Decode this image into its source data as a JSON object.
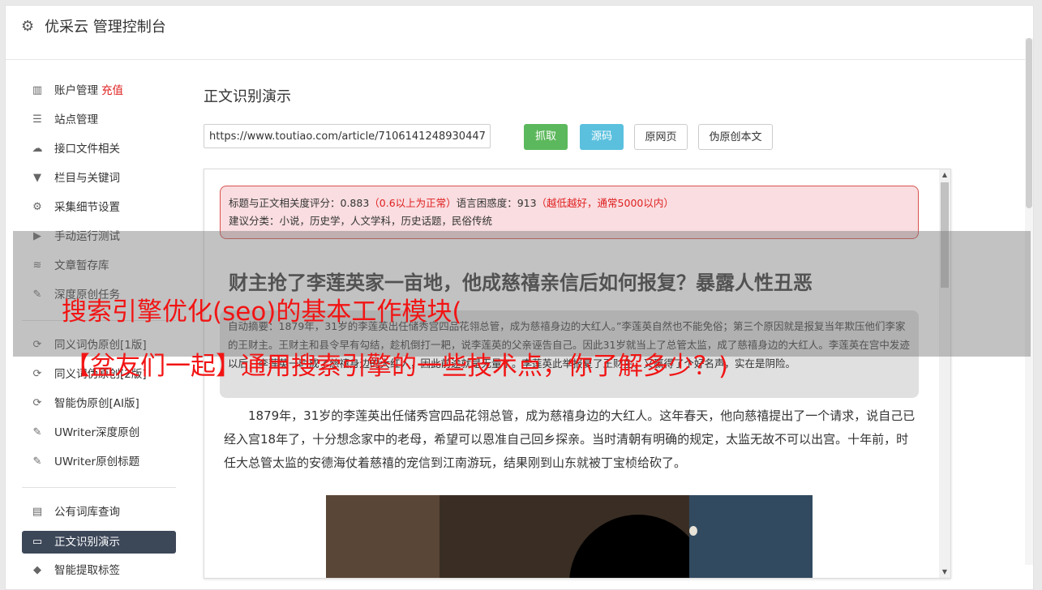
{
  "header": {
    "title": "优采云 管理控制台",
    "icon": "gear-icon"
  },
  "sidebar": {
    "items": [
      {
        "label": "账户管理",
        "badge": "充值",
        "icon": "bar-chart-icon",
        "glyph": "▥"
      },
      {
        "label": "站点管理",
        "icon": "server-icon",
        "glyph": "☰"
      },
      {
        "label": "接口文件相关",
        "icon": "cloud-upload-icon",
        "glyph": "☁"
      },
      {
        "label": "栏目与关键词",
        "icon": "filter-icon",
        "glyph": "▼"
      },
      {
        "label": "采集细节设置",
        "icon": "gears-icon",
        "glyph": "⚙"
      },
      {
        "label": "手动运行测试",
        "icon": "play-circle-icon",
        "glyph": "▶"
      },
      {
        "label": "文章暂存库",
        "icon": "database-icon",
        "glyph": "≋"
      },
      {
        "label": "深度原创任务",
        "icon": "edit-icon",
        "glyph": "✎"
      },
      {
        "label": "同义词伪原创[1版]",
        "icon": "refresh-icon",
        "glyph": "⟳"
      },
      {
        "label": "同义词伪原创[2版]",
        "icon": "refresh-icon",
        "glyph": "⟳"
      },
      {
        "label": "智能伪原创[AI版]",
        "icon": "refresh-icon",
        "glyph": "⟳"
      },
      {
        "label": "UWriter深度原创",
        "icon": "edit-icon",
        "glyph": "✎"
      },
      {
        "label": "UWriter原创标题",
        "icon": "edit-icon",
        "glyph": "✎"
      },
      {
        "label": "公有词库查询",
        "icon": "book-icon",
        "glyph": "▤"
      },
      {
        "label": "正文识别演示",
        "icon": "monitor-icon",
        "glyph": "▭"
      },
      {
        "label": "智能提取标签",
        "icon": "tag-icon",
        "glyph": "◆"
      }
    ]
  },
  "main": {
    "page_title": "正文识别演示",
    "url_value": "https://www.toutiao.com/article/7106141248930447",
    "buttons": {
      "fetch": "抓取",
      "source": "源码",
      "original": "原网页",
      "pseudo": "伪原创本文"
    }
  },
  "result": {
    "alert": {
      "score_label": "标题与正文相关度评分：0.883",
      "score_hint": "（0.6以上为正常）",
      "ppl_label": "语言困惑度：913",
      "ppl_hint": "（越低越好，通常5000以内）",
      "category": "建议分类：小说，历史学，人文学科，历史话题，民俗传统"
    },
    "article_title": "财主抢了李莲英家一亩地，他成慈禧亲信后如何报复？暴露人性丑恶",
    "summary": "自动摘要：1879年，31岁的李莲英出任储秀宫四品花翎总管，成为慈禧身边的大红人。”李莲英自然也不能免俗；第三个原因就是报复当年欺压他们李家的王财主。王财主和县令早有勾结，趁机倒打一耙，说李莲英的父亲诬告自己。因此31岁就当上了总管太监，成了慈禧身边的大红人。李莲英在宫中发迹以后，李莲英一时成了慈禧身边的大红人，因此前途就是无量了。李莲英此举报复了王财主，又赢得了个好名声，实在是阴险。",
    "paragraph": "1879年，31岁的李莲英出任储秀宫四品花翎总管，成为慈禧身边的大红人。这年春天，他向慈禧提出了一个请求，说自己已经入宫18年了，十分想念家中的老母，希望可以恩准自己回乡探亲。当时清朝有明确的规定，太监无故不可以出宫。十年前，时任大总管太监的安德海仗着慈禧的宠信到江南游玩，结果刚到山东就被丁宝桢给砍了。"
  },
  "overlay": {
    "line1": "搜索引擎优化(seo)的基本工作模块(",
    "line2": "【盆友们一起】通用搜索引擎的一些技术点，你了解多少？)"
  },
  "colors": {
    "accent_green": "#5cb85c",
    "accent_blue": "#5bc0de",
    "alert_red": "#e02020",
    "active_nav": "#3c4758"
  }
}
